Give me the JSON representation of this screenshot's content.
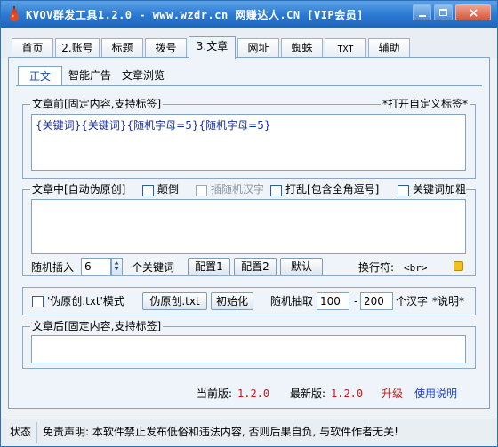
{
  "window": {
    "title": "KVOV群发工具1.2.0 - www.wzdr.cn 网赚达人.CN [VIP会员]"
  },
  "tabs": [
    {
      "label": "首页"
    },
    {
      "label": "2.账号"
    },
    {
      "label": "标题"
    },
    {
      "label": "拨号"
    },
    {
      "label": "3.文章"
    },
    {
      "label": "网址"
    },
    {
      "label": "蜘蛛"
    },
    {
      "label": "TXT"
    },
    {
      "label": "辅助"
    }
  ],
  "subtabs": [
    {
      "label": "正文"
    },
    {
      "label": "智能广告"
    },
    {
      "label": "文章浏览"
    }
  ],
  "before_group": {
    "legend": "文章前[固定内容,支持标签]",
    "custom_tag_link": "*打开自定义标签*",
    "content": "{关键词}{关键词}{随机字母=5}{随机字母=5}"
  },
  "middle_group": {
    "legend": "文章中[自动伪原创]",
    "reverse_label": "颠倒",
    "insert_random_hanzi_label": "插随机汉字",
    "shuffle_label": "打乱[包含全角逗号]",
    "keyword_bold_label": "关键词加粗",
    "content": "",
    "random_insert_label": "随机插入",
    "random_insert_value": "6",
    "keyword_unit": "个关键词",
    "config1_label": "配置1",
    "config2_label": "配置2",
    "default_label": "默认",
    "newline_label": "换行符:",
    "newline_value": "<br>"
  },
  "pseudo_row": {
    "mode_label": "'伪原创.txt'模式",
    "pseudo_button": "伪原创.txt",
    "init_button": "初始化",
    "random_extract_label": "随机抽取",
    "min_value": "100",
    "dash": "-",
    "max_value": "200",
    "hanzi_unit": "个汉字",
    "help_link": "*说明*"
  },
  "after_group": {
    "legend": "文章后[固定内容,支持标签]",
    "content": ""
  },
  "version": {
    "current_label": "当前版:",
    "current_value": "1.2.0",
    "latest_label": "最新版:",
    "latest_value": "1.2.0",
    "upgrade_link": "升级",
    "help_link": "使用说明"
  },
  "statusbar": {
    "status_label": "状态",
    "disclaimer": "免责声明: 本软件禁止发布低俗和违法内容, 否则后果自负, 与软件作者无关!"
  },
  "icons": {
    "app": "gourd-icon",
    "hint": "yellow-hint-icon"
  },
  "colors": {
    "title_bar": "#2a78d2",
    "version_red": "#c81818",
    "link_blue": "#1a3fcf"
  }
}
